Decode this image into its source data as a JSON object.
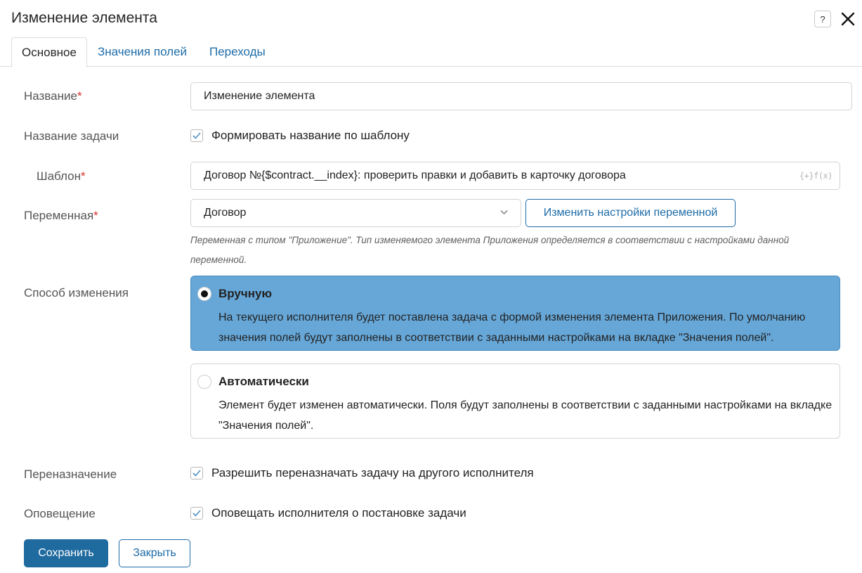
{
  "dialog": {
    "title": "Изменение элемента",
    "help_icon": "question-icon",
    "close_icon": "close-icon"
  },
  "tabs": [
    {
      "label": "Основное",
      "active": true
    },
    {
      "label": "Значения полей",
      "active": false
    },
    {
      "label": "Переходы",
      "active": false
    }
  ],
  "form": {
    "name": {
      "label": "Название",
      "required": "*",
      "value": "Изменение элемента"
    },
    "task_name": {
      "label": "Название задачи",
      "checkbox_label": "Формировать название по шаблону",
      "checked": true
    },
    "template": {
      "label": "Шаблон",
      "required": "*",
      "value": "Договор №{$contract.__index}: проверить правки и добавить в карточку договора",
      "fx_label": "{+}f(x)"
    },
    "variable": {
      "label": "Переменная",
      "required": "*",
      "value": "Договор",
      "button_label": "Изменить настройки переменной",
      "hint": "Переменная с типом \"Приложение\". Тип изменяемого элемента Приложения определяется в соответствии с настройками данной переменной."
    },
    "change_method": {
      "label": "Способ изменения",
      "options": [
        {
          "title": "Вручную",
          "description": "На текущего исполнителя будет поставлена задача с формой изменения элемента Приложения. По умолчанию значения полей будут заполнены в соответствии с заданными настройками на вкладке \"Значения полей\".",
          "selected": true
        },
        {
          "title": "Автоматически",
          "description": "Элемент будет изменен автоматически. Поля будут заполнены в соответствии с заданными настройками на вкладке \"Значения полей\".",
          "selected": false
        }
      ]
    },
    "reassign": {
      "label": "Переназначение",
      "checkbox_label": "Разрешить переназначать задачу на другого исполнителя",
      "checked": true
    },
    "notify": {
      "label": "Оповещение",
      "checkbox_label": "Оповещать исполнителя о постановке задачи",
      "checked": true
    }
  },
  "footer": {
    "save_label": "Сохранить",
    "close_label": "Закрыть"
  },
  "colors": {
    "accent": "#1e6ca8",
    "primary_button": "#1f6a9f",
    "selected_option": "#66a7d8",
    "required": "#d9302b"
  }
}
